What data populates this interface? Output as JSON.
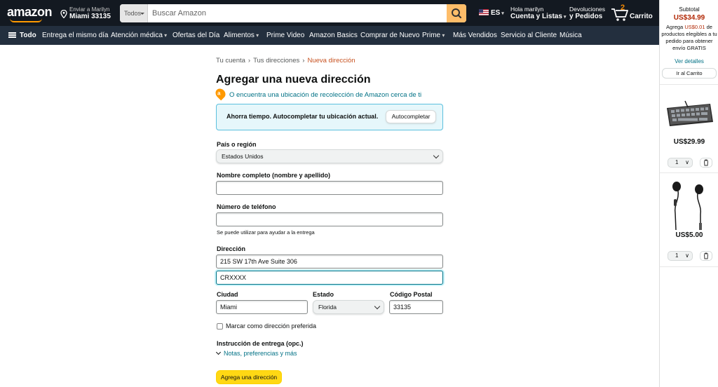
{
  "header": {
    "logo": "amazon",
    "deliver_line1": "Enviar a Marilyn",
    "deliver_line2": "Miami 33135",
    "search_category": "Todos",
    "search_placeholder": "Buscar Amazon",
    "language": "ES",
    "account_line1": "Hola marilyn",
    "account_line2": "Cuenta y Listas",
    "orders_line1": "Devoluciones",
    "orders_line2": "y Pedidos",
    "cart_count": "2",
    "cart_label": "Carrito"
  },
  "subnav": {
    "all": "Todo",
    "items": [
      "Entrega el mismo día",
      "Atención médica",
      "Ofertas del Día",
      "Alimentos",
      "Prime Video",
      "Amazon Basics",
      "Comprar de Nuevo",
      "Prime",
      "Más Vendidos",
      "Servicio al Cliente",
      "Música"
    ]
  },
  "breadcrumb": {
    "items": [
      "Tu cuenta",
      "Tus direcciones",
      "Nueva dirección"
    ]
  },
  "form": {
    "title": "Agregar una nueva dirección",
    "pickup_badge": "a",
    "pickup_link": "O encuentra una ubicación de recolección de Amazon cerca de ti",
    "autocomplete_text": "Ahorra tiempo. Autocompletar tu ubicación actual.",
    "autocomplete_button": "Autocompletar",
    "country_label": "País o región",
    "country_value": "Estados Unidos",
    "fullname_label": "Nombre completo (nombre y apellido)",
    "fullname_value": "",
    "phone_label": "Número de teléfono",
    "phone_value": "",
    "phone_hint": "Se puede utilizar para ayudar a la entrega",
    "address_label": "Dirección",
    "address_line1": "215 SW 17th Ave Suite 306",
    "address_line2": "CRXXXX",
    "city_label": "Ciudad",
    "city_value": "Miami",
    "state_label": "Estado",
    "state_value": "Florida",
    "zip_label": "Código Postal",
    "zip_value": "33135",
    "default_checkbox": "Marcar como dirección preferida",
    "delivery_label": "Instrucción de entrega (opc.)",
    "delivery_link": "Notas, preferencias y más",
    "submit": "Agrega una dirección"
  },
  "side_cart": {
    "subtotal_label": "Subtotal",
    "subtotal_value": "US$34.99",
    "note_prefix": "Agrega",
    "note_amount": "US$0.01",
    "note_suffix": "de productos elegibles a tu pedido para obtener envío GRATIS",
    "details_link": "Ver detalles",
    "go_cart": "Ir al Carrito",
    "items": [
      {
        "price": "US$29.99",
        "qty": "1",
        "icon": "keyboard-image"
      },
      {
        "price": "US$5.00",
        "qty": "1",
        "icon": "earphones-image"
      }
    ]
  }
}
